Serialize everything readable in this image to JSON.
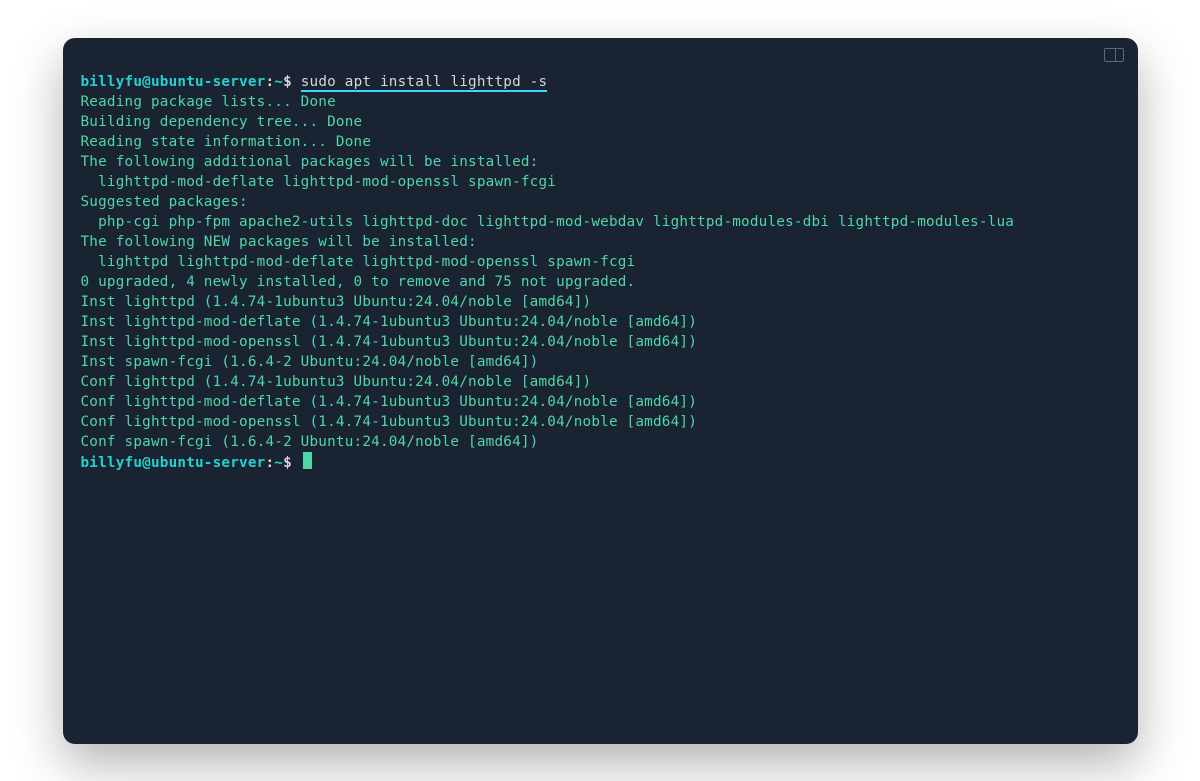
{
  "prompt": {
    "host": "billyfu@ubuntu-server",
    "sep": ":",
    "path": "~",
    "symbol": "$"
  },
  "command": "sudo apt install lighttpd -s",
  "output": [
    "Reading package lists... Done",
    "Building dependency tree... Done",
    "Reading state information... Done",
    "The following additional packages will be installed:",
    "  lighttpd-mod-deflate lighttpd-mod-openssl spawn-fcgi",
    "Suggested packages:",
    "  php-cgi php-fpm apache2-utils lighttpd-doc lighttpd-mod-webdav lighttpd-modules-dbi lighttpd-modules-lua",
    "The following NEW packages will be installed:",
    "  lighttpd lighttpd-mod-deflate lighttpd-mod-openssl spawn-fcgi",
    "0 upgraded, 4 newly installed, 0 to remove and 75 not upgraded.",
    "Inst lighttpd (1.4.74-1ubuntu3 Ubuntu:24.04/noble [amd64])",
    "Inst lighttpd-mod-deflate (1.4.74-1ubuntu3 Ubuntu:24.04/noble [amd64])",
    "Inst lighttpd-mod-openssl (1.4.74-1ubuntu3 Ubuntu:24.04/noble [amd64])",
    "Inst spawn-fcgi (1.6.4-2 Ubuntu:24.04/noble [amd64])",
    "Conf lighttpd (1.4.74-1ubuntu3 Ubuntu:24.04/noble [amd64])",
    "Conf lighttpd-mod-deflate (1.4.74-1ubuntu3 Ubuntu:24.04/noble [amd64])",
    "Conf lighttpd-mod-openssl (1.4.74-1ubuntu3 Ubuntu:24.04/noble [amd64])",
    "Conf spawn-fcgi (1.6.4-2 Ubuntu:24.04/noble [amd64])"
  ]
}
